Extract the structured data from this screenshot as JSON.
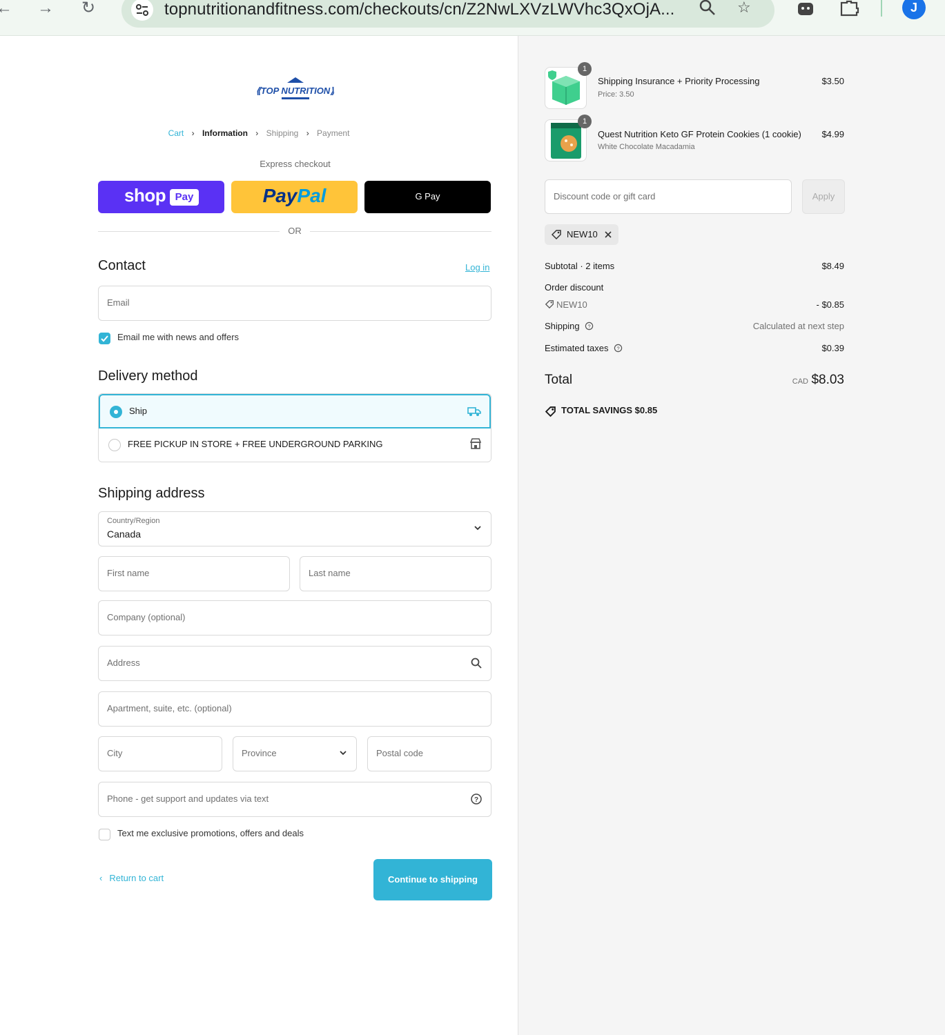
{
  "browser": {
    "url": "topnutritionandfitness.com/checkouts/cn/Z2NwLXVzLWVhc3QxOjA...",
    "profile_initial": "J"
  },
  "store": {
    "logo_text": "TOP NUTRITION"
  },
  "breadcrumb": {
    "cart": "Cart",
    "information": "Information",
    "shipping": "Shipping",
    "payment": "Payment"
  },
  "express": {
    "label": "Express checkout",
    "shop_pay": "shop",
    "shop_pay_chip": "Pay",
    "paypal": "PayPal",
    "gpay": "G Pay",
    "or_label": "OR"
  },
  "contact": {
    "title": "Contact",
    "login_link": "Log in",
    "email_placeholder": "Email",
    "newsletter_label": "Email me with news and offers",
    "newsletter_checked": true
  },
  "delivery": {
    "title": "Delivery method",
    "options": [
      {
        "label": "Ship",
        "selected": true,
        "icon": "truck-icon"
      },
      {
        "label": "FREE PICKUP IN STORE + FREE UNDERGROUND PARKING",
        "selected": false,
        "icon": "store-icon"
      }
    ]
  },
  "shipping_address": {
    "title": "Shipping address",
    "country_label": "Country/Region",
    "country_value": "Canada",
    "first_name": "First name",
    "last_name": "Last name",
    "company": "Company (optional)",
    "address": "Address",
    "apartment": "Apartment, suite, etc. (optional)",
    "city": "City",
    "province": "Province",
    "postal_code": "Postal code",
    "phone": "Phone - get support and updates via text",
    "sms_label": "Text me exclusive promotions, offers and deals"
  },
  "actions": {
    "return_to_cart": "Return to cart",
    "continue": "Continue to shipping"
  },
  "order": {
    "items": [
      {
        "name": "Shipping Insurance + Priority Processing",
        "sub": "Price: 3.50",
        "price": "$3.50",
        "qty": "1"
      },
      {
        "name": "Quest Nutrition Keto GF Protein Cookies (1 cookie)",
        "sub": "White Chocolate Macadamia",
        "price": "$4.99",
        "qty": "1"
      }
    ],
    "discount_placeholder": "Discount code or gift card",
    "apply_label": "Apply",
    "applied_code": "NEW10",
    "subtotal_label": "Subtotal · 2 items",
    "subtotal_value": "$8.49",
    "order_discount_label": "Order discount",
    "discount_code": "NEW10",
    "discount_value": "- $0.85",
    "shipping_label": "Shipping",
    "shipping_value": "Calculated at next step",
    "taxes_label": "Estimated taxes",
    "taxes_value": "$0.39",
    "total_label": "Total",
    "currency": "CAD",
    "total_value": "$8.03",
    "savings": "TOTAL SAVINGS  $0.85"
  },
  "colors": {
    "accent": "#32b4d6",
    "shop_pay": "#5a31f4",
    "paypal": "#ffc439"
  }
}
